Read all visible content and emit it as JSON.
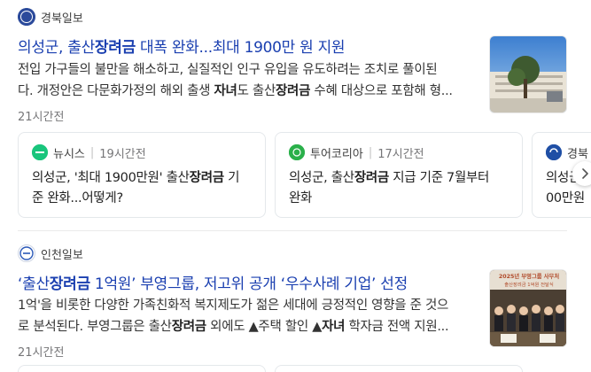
{
  "articles": [
    {
      "press": "경북일보",
      "press_logo_text": "경북",
      "headline": {
        "pre": "의성군, 출산",
        "kw": "장려금",
        "post": " 대폭 완화...최대 1900만 원 지원"
      },
      "summary": {
        "line1": "전입 가구들의 불만을 해소하고, 실질적인 인구 유입을 유도하려는 조치로 풀이된",
        "line2_pre": "다. 개정안은 다문화가정의 해외 출생 ",
        "line2_kw1": "자녀",
        "line2_mid": "도 출산",
        "line2_kw2": "장려금",
        "line2_post": " 수혜 대상으로 포함해 형..."
      },
      "time": "21시간전",
      "related": [
        {
          "press": "뉴시스",
          "time": "19시간전",
          "title": {
            "l1_pre": "의성군, '최대 1900만원' 출산",
            "l1_kw": "장려금",
            "l1_post": " 기",
            "l2": "준 완화...어떻게?"
          }
        },
        {
          "press": "투어코리아",
          "time": "17시간전",
          "title": {
            "l1_pre": "의성군, 출산",
            "l1_kw": "장려금",
            "l1_post": " 지급 기준 7월부터",
            "l2": "완화"
          }
        },
        {
          "press": "경북",
          "time": "",
          "title": {
            "l1_pre": "의성군",
            "l1_kw": "",
            "l1_post": "",
            "l2": "00만원"
          }
        }
      ]
    },
    {
      "press": "인천일보",
      "headline": {
        "pre": "‘출산",
        "kw": "장려금",
        "post": " 1억원’ 부영그룹, 저고위 공개 ‘우수사례 기업’ 선정"
      },
      "summary": {
        "line1": "1억'을 비롯한 다양한 가족친화적 복지제도가 젊은 세대에 긍정적인 영향을 준 것으",
        "line2_pre": "로 분석된다. 부영그룹은 출산",
        "line2_kw1": "장려금",
        "line2_mid": " 외에도 ▲주택 할인 ▲",
        "line2_kw2": "자녀",
        "line2_post": " 학자금 전액 지원..."
      },
      "time": "21시간전",
      "thumb_banner_line1": "2025년 부영그룹 사무처",
      "thumb_banner_line2": "출산장려금 1억원 전달식"
    }
  ],
  "colors": {
    "headline": "#1a3fb0",
    "nate_green": "#19c57c",
    "tour_green": "#2ab04a",
    "gyeongbuk_blue": "#2b4a9b"
  },
  "icons": {
    "next": "chevron-right-icon"
  }
}
